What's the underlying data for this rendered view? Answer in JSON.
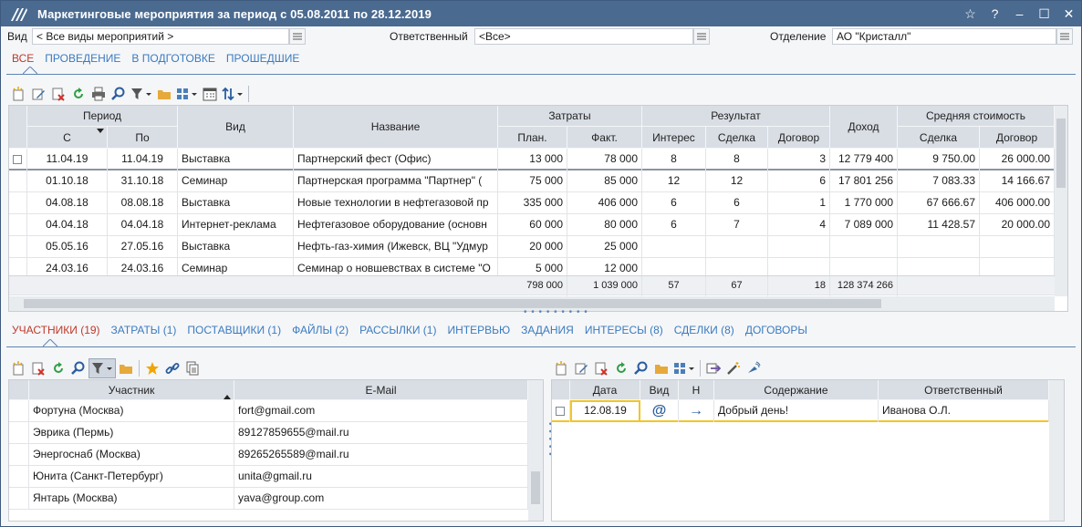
{
  "window": {
    "title": "Маркетинговые мероприятия за период с 05.08.2011 по 28.12.2019",
    "controls": [
      "☆",
      "?",
      "–",
      "☐",
      "✕"
    ]
  },
  "filters": {
    "vid_label": "Вид",
    "vid_value": "< Все виды мероприятий >",
    "resp_label": "Ответственный",
    "resp_value": "<Все>",
    "dept_label": "Отделение",
    "dept_value": "АО \"Кристалл\""
  },
  "top_tabs": [
    {
      "label": "ВСЕ",
      "active": true
    },
    {
      "label": "ПРОВЕДЕНИЕ",
      "active": false
    },
    {
      "label": "В ПОДГОТОВКЕ",
      "active": false
    },
    {
      "label": "ПРОШЕДШИЕ",
      "active": false
    }
  ],
  "main_grid": {
    "group_headers": {
      "period": "Период",
      "costs": "Затраты",
      "result": "Результат",
      "avg": "Средняя стоимость"
    },
    "headers": {
      "from": "С",
      "to": "По",
      "kind": "Вид",
      "name": "Название",
      "plan": "План.",
      "fact": "Факт.",
      "interest": "Интерес",
      "deal": "Сделка",
      "contract": "Договор",
      "income": "Доход",
      "avg_deal": "Сделка",
      "avg_contract": "Договор"
    },
    "rows": [
      {
        "from": "11.04.19",
        "to": "11.04.19",
        "kind": "Выставка",
        "name": "Партнерский фест (Офис)",
        "plan": "13 000",
        "fact": "78 000",
        "interest": "8",
        "deal": "8",
        "contract": "3",
        "income": "12 779 400",
        "avg_deal": "9 750.00",
        "avg_contract": "26 000.00"
      },
      {
        "from": "01.10.18",
        "to": "31.10.18",
        "kind": "Семинар",
        "name": "Партнерская программа \"Партнер\" (",
        "plan": "75 000",
        "fact": "85 000",
        "interest": "12",
        "deal": "12",
        "contract": "6",
        "income": "17 801 256",
        "avg_deal": "7 083.33",
        "avg_contract": "14 166.67"
      },
      {
        "from": "04.08.18",
        "to": "08.08.18",
        "kind": "Выставка",
        "name": "Новые технологии в нефтегазовой пр",
        "plan": "335 000",
        "fact": "406 000",
        "interest": "6",
        "deal": "6",
        "contract": "1",
        "income": "1 770 000",
        "avg_deal": "67 666.67",
        "avg_contract": "406 000.00"
      },
      {
        "from": "04.04.18",
        "to": "04.04.18",
        "kind": "Интернет-реклама",
        "name": "Нефтегазовое оборудование (основн",
        "plan": "60 000",
        "fact": "80 000",
        "interest": "6",
        "deal": "7",
        "contract": "4",
        "income": "7 089 000",
        "avg_deal": "11 428.57",
        "avg_contract": "20 000.00"
      },
      {
        "from": "05.05.16",
        "to": "27.05.16",
        "kind": "Выставка",
        "name": "Нефть-газ-химия (Ижевск, ВЦ \"Удмур",
        "plan": "20 000",
        "fact": "25 000",
        "interest": "",
        "deal": "",
        "contract": "",
        "income": "",
        "avg_deal": "",
        "avg_contract": ""
      },
      {
        "from": "24.03.16",
        "to": "24.03.16",
        "kind": "Семинар",
        "name": "Семинар о новшевствах в системе \"О",
        "plan": "5 000",
        "fact": "12 000",
        "interest": "",
        "deal": "",
        "contract": "",
        "income": "",
        "avg_deal": "",
        "avg_contract": ""
      }
    ],
    "totals": {
      "plan": "798 000",
      "fact": "1 039 000",
      "interest": "57",
      "deal": "67",
      "contract": "18",
      "income": "128 374 266"
    }
  },
  "bottom_tabs": [
    {
      "label": "УЧАСТНИКИ (19)",
      "active": true
    },
    {
      "label": "ЗАТРАТЫ (1)",
      "active": false
    },
    {
      "label": "ПОСТАВЩИКИ (1)",
      "active": false
    },
    {
      "label": "ФАЙЛЫ (2)",
      "active": false
    },
    {
      "label": "РАССЫЛКИ (1)",
      "active": false
    },
    {
      "label": "ИНТЕРВЬЮ",
      "active": false
    },
    {
      "label": "ЗАДАНИЯ",
      "active": false
    },
    {
      "label": "ИНТЕРЕСЫ (8)",
      "active": false
    },
    {
      "label": "СДЕЛКИ (8)",
      "active": false
    },
    {
      "label": "ДОГОВОРЫ",
      "active": false
    }
  ],
  "participants": {
    "headers": {
      "participant": "Участник",
      "email": "E-Mail"
    },
    "rows": [
      {
        "participant": "Фортуна (Москва)",
        "email": "fort@gmail.com"
      },
      {
        "participant": "Эврика (Пермь)",
        "email": "89127859655@mail.ru"
      },
      {
        "participant": "Энергоснаб (Москва)",
        "email": "89265265589@mail.ru"
      },
      {
        "participant": "Юнита (Санкт-Петербург)",
        "email": "unita@gmail.ru"
      },
      {
        "participant": "Янтарь (Москва)",
        "email": "yava@group.com"
      }
    ]
  },
  "messages": {
    "headers": {
      "date": "Дата",
      "kind": "Вид",
      "dir": "Н",
      "content": "Содержание",
      "responsible": "Ответственный"
    },
    "rows": [
      {
        "date": "12.08.19",
        "kind": "@",
        "dir": "→",
        "content": "Добрый день!",
        "responsible": "Иванова О.Л."
      }
    ]
  },
  "colors": {
    "titlebar": "#4a6a90",
    "tab_active": "#c0392b",
    "tab": "#3a7bbf",
    "header_bg": "#d9dee5",
    "selection": "#f3c623"
  }
}
